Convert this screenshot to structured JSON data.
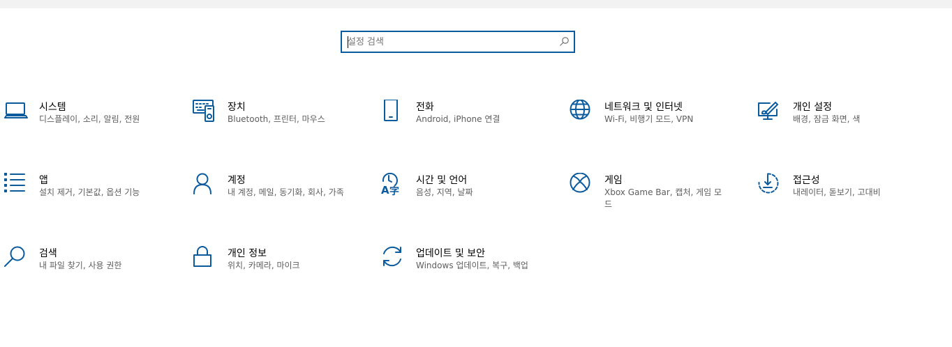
{
  "search": {
    "placeholder": "설정 검색"
  },
  "tiles": [
    {
      "title": "시스템",
      "desc": "디스플레이, 소리, 알림, 전원",
      "icon": "laptop-icon"
    },
    {
      "title": "장치",
      "desc": "Bluetooth, 프린터, 마우스",
      "icon": "devices-icon"
    },
    {
      "title": "전화",
      "desc": "Android, iPhone 연결",
      "icon": "phone-icon"
    },
    {
      "title": "네트워크 및 인터넷",
      "desc": "Wi-Fi, 비행기 모드, VPN",
      "icon": "globe-icon"
    },
    {
      "title": "개인 설정",
      "desc": "배경, 잠금 화면, 색",
      "icon": "personalization-icon"
    },
    {
      "title": "앱",
      "desc": "설치 제거, 기본값, 옵션 기능",
      "icon": "apps-list-icon"
    },
    {
      "title": "계정",
      "desc": "내 계정, 메일, 동기화, 회사, 가족",
      "icon": "person-icon"
    },
    {
      "title": "시간 및 언어",
      "desc": "음성, 지역, 날짜",
      "icon": "time-language-icon"
    },
    {
      "title": "게임",
      "desc": "Xbox Game Bar, 캡처, 게임 모드",
      "icon": "xbox-icon"
    },
    {
      "title": "접근성",
      "desc": "내레이터, 돋보기, 고대비",
      "icon": "ease-of-access-icon"
    },
    {
      "title": "검색",
      "desc": "내 파일 찾기, 사용 권한",
      "icon": "search-icon"
    },
    {
      "title": "개인 정보",
      "desc": "위치, 카메라, 마이크",
      "icon": "lock-icon"
    },
    {
      "title": "업데이트 및 보안",
      "desc": "Windows 업데이트, 복구, 백업",
      "icon": "sync-icon"
    }
  ],
  "colors": {
    "accent": "#0a5a9e",
    "description_text": "#5d5d5d",
    "top_bar": "#f2f2f2"
  }
}
